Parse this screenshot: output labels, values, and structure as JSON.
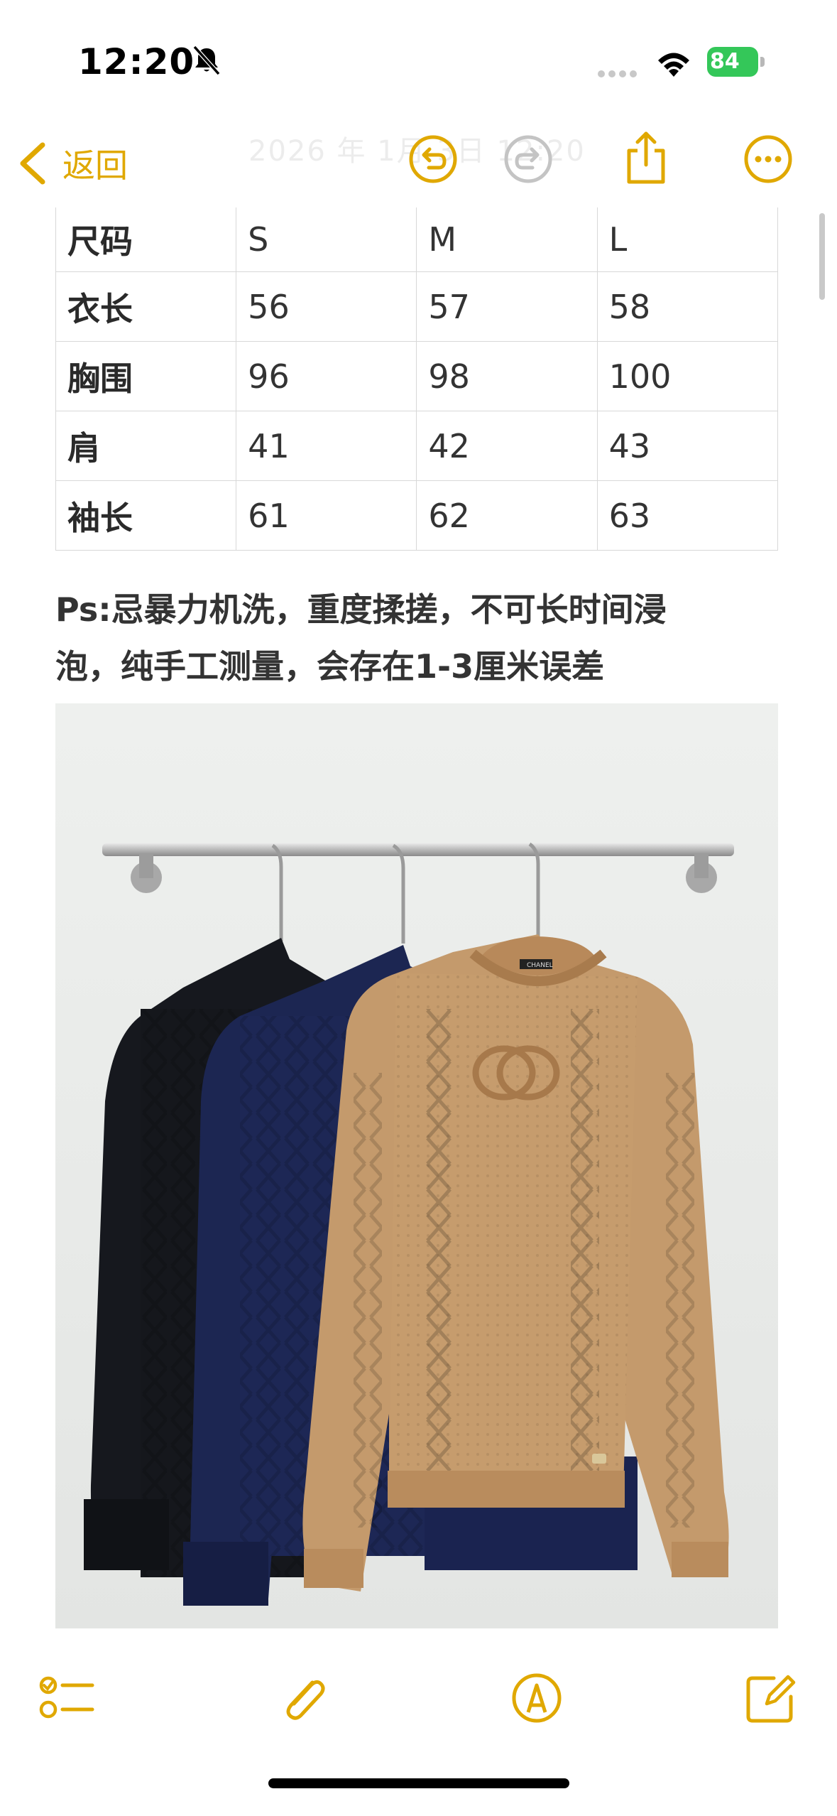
{
  "status_bar": {
    "time": "12:20",
    "battery": "84",
    "accent_battery": "#34c759"
  },
  "nav": {
    "back_label": "返回",
    "date_faded": "2026 年 1月 3日 12:20",
    "accent": "#e0a800",
    "icons": [
      "chevron-left-icon",
      "undo-icon",
      "redo-icon",
      "share-icon",
      "more-icon"
    ]
  },
  "size_table": {
    "headers": [
      "尺码",
      "S",
      "M",
      "L"
    ],
    "rows": [
      [
        "衣长",
        "56",
        "57",
        "58"
      ],
      [
        "胸围",
        "96",
        "98",
        "100"
      ],
      [
        "肩",
        "41",
        "42",
        "43"
      ],
      [
        "袖长",
        "61",
        "62",
        "63"
      ]
    ]
  },
  "note": {
    "line1": "Ps:忌暴力机洗，重度揉搓，不可长时间浸",
    "line2": "泡，纯手工测量，会存在1-3厘米误差"
  },
  "photo": {
    "logo_text": "CHANEL"
  },
  "toolbar": {
    "icons": [
      "checklist-icon",
      "attachment-icon",
      "markup-icon",
      "compose-icon"
    ]
  }
}
